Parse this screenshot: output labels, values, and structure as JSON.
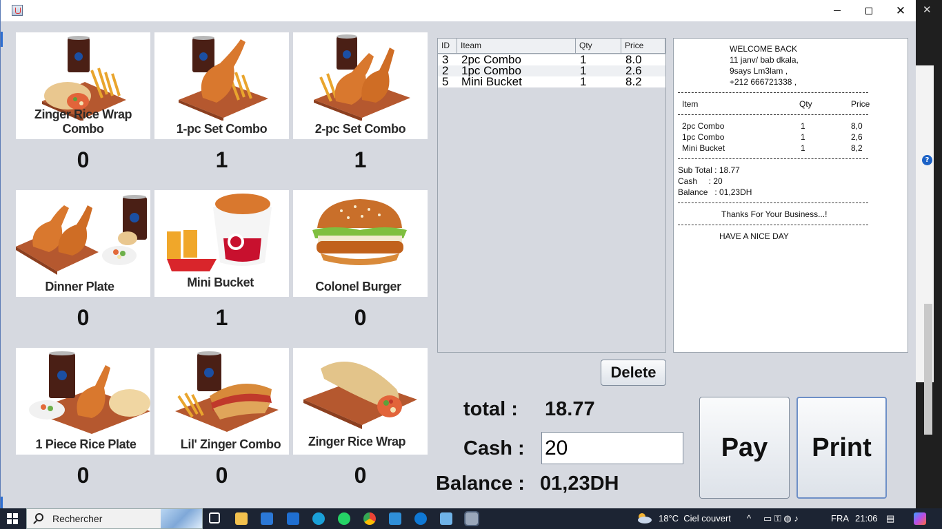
{
  "window": {
    "title": ""
  },
  "products": [
    {
      "name": "Zinger Rice Wrap Combo",
      "qty": "0"
    },
    {
      "name": "1-pc Set Combo",
      "qty": "1"
    },
    {
      "name": "2-pc Set Combo",
      "qty": "1"
    },
    {
      "name": "Dinner Plate",
      "qty": "0"
    },
    {
      "name": "Mini Bucket",
      "qty": "1"
    },
    {
      "name": "Colonel Burger",
      "qty": "0"
    },
    {
      "name": "1 Piece Rice Plate",
      "qty": "0"
    },
    {
      "name": "Lil' Zinger Combo",
      "qty": "0"
    },
    {
      "name": "Zinger Rice Wrap",
      "qty": "0"
    }
  ],
  "order_table": {
    "headers": [
      "ID",
      "Iteam",
      "Qty",
      "Price"
    ],
    "rows": [
      [
        "3",
        "2pc Combo",
        "1",
        "8.0"
      ],
      [
        "2",
        "1pc Combo",
        "1",
        "2.6"
      ],
      [
        "5",
        "Mini Bucket",
        "1",
        "8.2"
      ]
    ]
  },
  "receipt": {
    "welcome": "WELCOME BACK",
    "address1": "11 janv/ bab dkala,",
    "address2": "9says Lm3lam ,",
    "phone": "+212 666721338 ,",
    "col_item": "Item",
    "col_qty": "Qty",
    "col_price": "Price",
    "lines": [
      [
        "2pc Combo",
        "1",
        "8,0"
      ],
      [
        "1pc Combo",
        "1",
        "2,6"
      ],
      [
        "Mini Bucket",
        "1",
        "8,2"
      ]
    ],
    "subtotal": "Sub Total : 18.77",
    "cash": "Cash     : 20",
    "balance": "Balance   : 01,23DH",
    "thanks": "Thanks For Your Business...!",
    "goodbye": "HAVE A NICE DAY"
  },
  "actions": {
    "delete": "Delete",
    "pay": "Pay",
    "print": "Print"
  },
  "totals": {
    "total_label": "total :",
    "total_value": "18.77",
    "cash_label": "Cash :",
    "cash_value": "20",
    "balance_label": "Balance :",
    "balance_value": "01,23DH"
  },
  "taskbar": {
    "search_placeholder": "Rechercher",
    "weather": "18°C  Ciel couvert",
    "language": "FRA",
    "time": "21:06"
  },
  "colors": {
    "window_bg": "#d6d9e0",
    "accent": "#2f6fd1",
    "taskbar": "#1c2433"
  }
}
